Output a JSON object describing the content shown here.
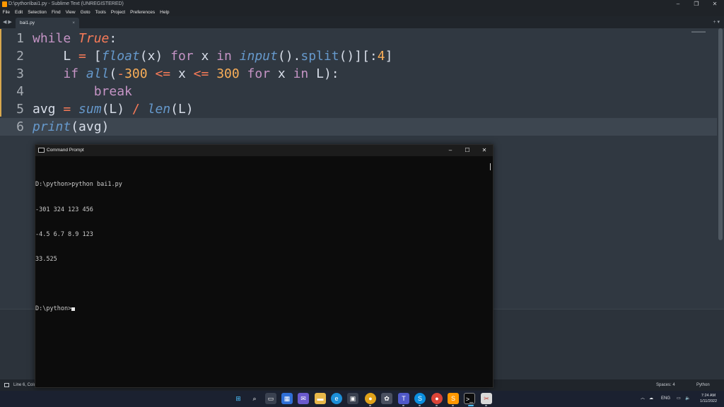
{
  "window": {
    "title": "D:\\python\\bai1.py - Sublime Text (UNREGISTERED)"
  },
  "menu": [
    "File",
    "Edit",
    "Selection",
    "Find",
    "View",
    "Goto",
    "Tools",
    "Project",
    "Preferences",
    "Help"
  ],
  "tabs": {
    "active": "bai1.py",
    "close": "×",
    "nav": "◀ ▶",
    "right_controls": "+ ▾"
  },
  "editor": {
    "line_numbers": [
      "1",
      "2",
      "3",
      "4",
      "5",
      "6"
    ],
    "current_line": 6
  },
  "status": {
    "position": "Line 6, Colu",
    "spaces": "Spaces: 4",
    "syntax": "Python"
  },
  "cmd": {
    "title": "Command Prompt",
    "lines": [
      "",
      "D:\\python>python bai1.py",
      "-301 324 123 456",
      "-4.5 6.7 8.9 123",
      "33.525",
      "",
      "D:\\python>"
    ]
  },
  "taskbar": {
    "icons": [
      "windows-start",
      "search",
      "task-view",
      "widgets",
      "chat",
      "file-explorer",
      "edge",
      "store",
      "chrome-canary",
      "photos",
      "teams",
      "skype",
      "chrome",
      "sublime-text",
      "terminal",
      "snipping-tool"
    ],
    "lang": "ENG",
    "time": "7:24 AM",
    "date": "1/11/2022"
  }
}
